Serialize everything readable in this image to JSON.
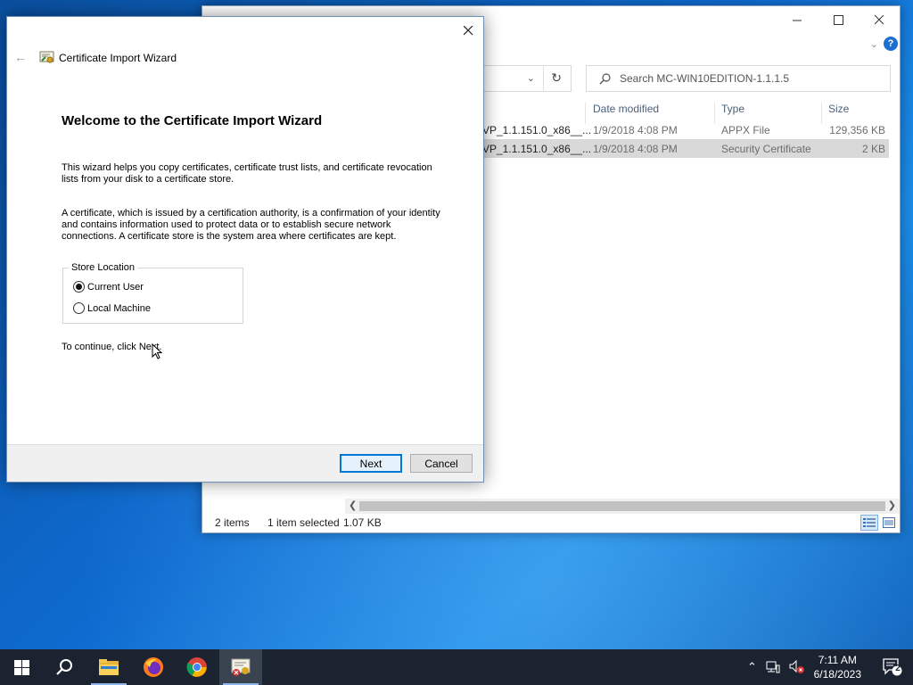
{
  "explorer": {
    "search_placeholder": "Search MC-WIN10EDITION-1.1.1.5",
    "columns": {
      "date_modified": "Date modified",
      "type": "Type",
      "size": "Size"
    },
    "files": [
      {
        "name": "VP_1.1.151.0_x86__...",
        "date": "1/9/2018 4:08 PM",
        "type": "APPX File",
        "size": "129,356 KB"
      },
      {
        "name": "VP_1.1.151.0_x86__...",
        "date": "1/9/2018 4:08 PM",
        "type": "Security Certificate",
        "size": "2 KB"
      }
    ],
    "status": {
      "items": "2 items",
      "selected": "1 item selected",
      "selected_size": "1.07 KB"
    }
  },
  "wizard": {
    "title": "Certificate Import Wizard",
    "heading": "Welcome to the Certificate Import Wizard",
    "para1_line1": "This wizard helps you copy certificates, certificate trust lists, and certificate revocation",
    "para1_line2": "lists from your disk to a certificate store.",
    "para2_line1": "A certificate, which is issued by a certification authority, is a confirmation of your identity",
    "para2_line2": "and contains information used to protect data or to establish secure network",
    "para2_line3": "connections. A certificate store is the system area where certificates are kept.",
    "store_location_label": "Store Location",
    "options": [
      {
        "label": "Current User",
        "checked": true
      },
      {
        "label": "Local Machine",
        "checked": false
      }
    ],
    "continue_text": "To continue, click Next.",
    "next_label": "Next",
    "cancel_label": "Cancel"
  },
  "taskbar": {
    "time": "7:11 AM",
    "date": "6/18/2023",
    "notification_count": "2",
    "apps": [
      "start-icon",
      "search-icon",
      "file-explorer-icon",
      "firefox-icon",
      "chrome-icon",
      "certificate-wizard-icon"
    ]
  },
  "colors": {
    "accent": "#0078d7",
    "taskbar": "#1b2330",
    "selection": "#d9d9d9"
  }
}
